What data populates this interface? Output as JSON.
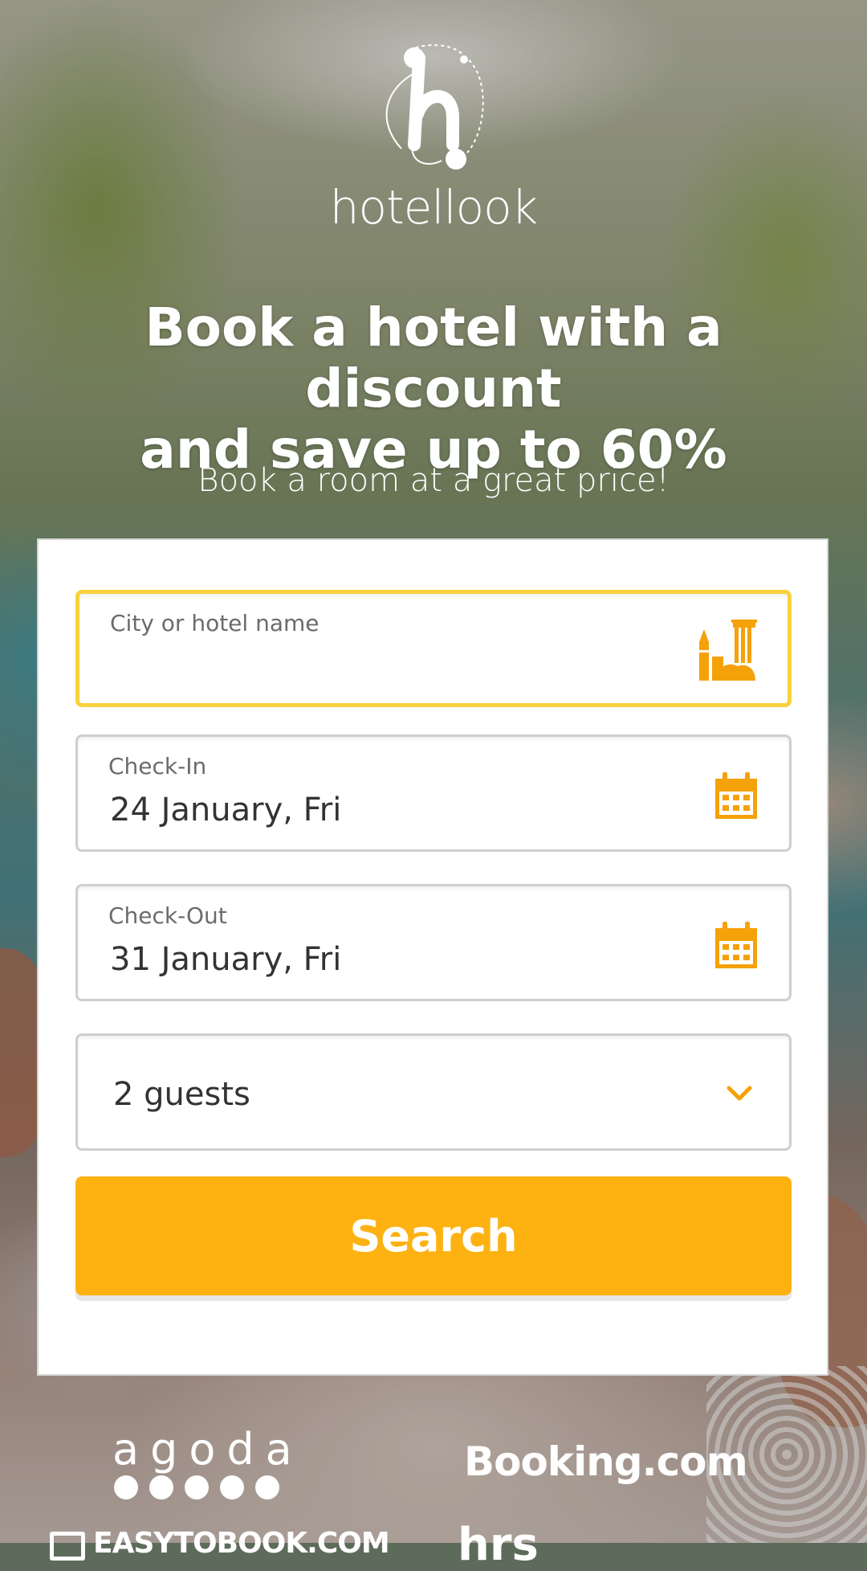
{
  "brand": {
    "name": "hotellook",
    "accent_color": "#fdb212",
    "focus_color": "#f7d23c",
    "icon_color": "#f5a10a"
  },
  "hero": {
    "headline_line1": "Book a hotel with a discount",
    "headline_line2": "and save up to 60%",
    "subtitle": "Book a room at a great price!"
  },
  "form": {
    "destination": {
      "label": "City or hotel name",
      "value": "",
      "icon": "city-landmarks-icon"
    },
    "check_in": {
      "label": "Check-In",
      "value": "24 January, Fri",
      "icon": "calendar-icon"
    },
    "check_out": {
      "label": "Check-Out",
      "value": "31 January, Fri",
      "icon": "calendar-icon"
    },
    "guests": {
      "value": "2 guests",
      "icon": "chevron-down-icon"
    },
    "search_label": "Search"
  },
  "partners": {
    "agoda": "agoda",
    "booking": "Booking.com",
    "easytobook": "EASYTOBOOK.COM",
    "hrs": "hrs"
  }
}
